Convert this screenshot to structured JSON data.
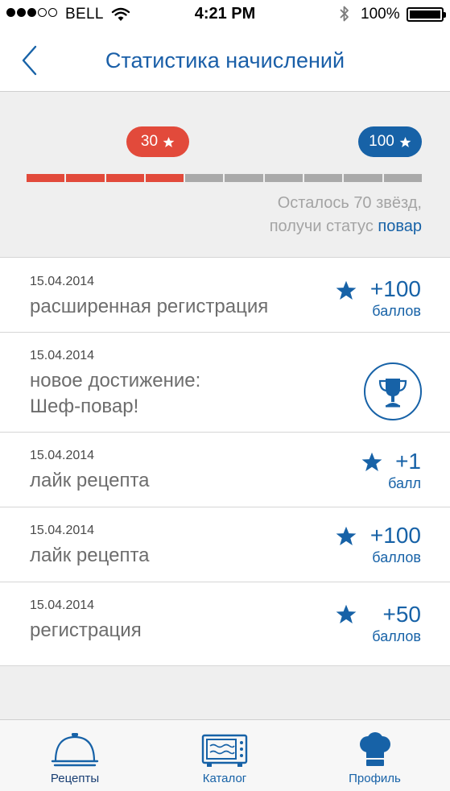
{
  "status_bar": {
    "carrier": "BELL",
    "time": "4:21 PM",
    "battery": "100%",
    "signal_filled": 3,
    "signal_total": 5
  },
  "nav": {
    "title": "Статистика начислений",
    "back_icon": "chevron-left-icon"
  },
  "progress": {
    "current_label": "30",
    "target_label": "100",
    "current_value": 30,
    "target_value": 100,
    "segments_total": 10,
    "segments_filled": 4,
    "remaining_line1": "Осталось 70 звёзд,",
    "remaining_line2_prefix": "получи статус ",
    "remaining_status": "повар",
    "colors": {
      "filled": "#e24a3b",
      "empty": "#a9a9a9",
      "target": "#1762a7"
    }
  },
  "entries": [
    {
      "date": "15.04.2014",
      "title": "расширенная регистрация",
      "points": "+100",
      "unit": "баллов",
      "icon": "star-icon"
    },
    {
      "date": "15.04.2014",
      "title_line1": "новое достижение:",
      "title_line2": "Шеф-повар!",
      "icon": "trophy-icon"
    },
    {
      "date": "15.04.2014",
      "title": "лайк рецепта",
      "points": "+1",
      "unit": "балл",
      "icon": "star-icon"
    },
    {
      "date": "15.04.2014",
      "title": "лайк рецепта",
      "points": "+100",
      "unit": "баллов",
      "icon": "star-icon"
    },
    {
      "date": "15.04.2014",
      "title": "регистрация",
      "points": "+50",
      "unit": "баллов",
      "icon": "star-icon"
    }
  ],
  "tabs": [
    {
      "label": "Рецепты",
      "icon": "cloche-icon",
      "active": true
    },
    {
      "label": "Каталог",
      "icon": "oven-icon",
      "active": false
    },
    {
      "label": "Профиль",
      "icon": "chef-hat-icon",
      "active": false
    }
  ],
  "accent_color": "#1762a7"
}
